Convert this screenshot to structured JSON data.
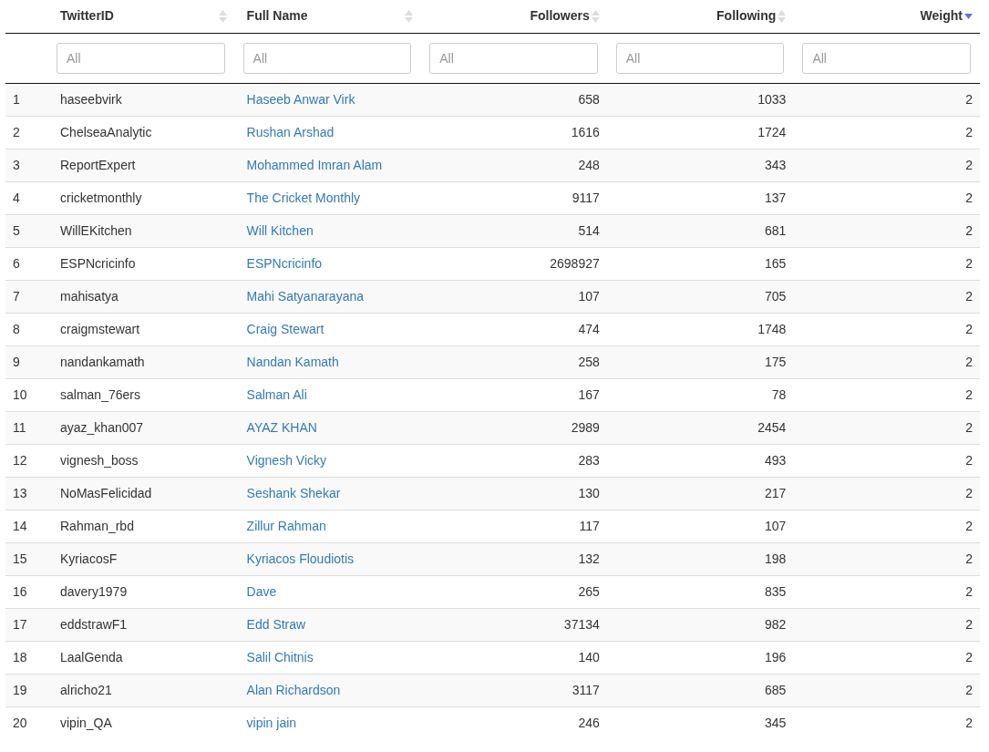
{
  "table": {
    "columns": [
      {
        "label": "TwitterID",
        "kind": "text",
        "sorted_descending": false
      },
      {
        "label": "Full Name",
        "kind": "text",
        "sorted_descending": false
      },
      {
        "label": "Followers",
        "kind": "number",
        "sorted_descending": false
      },
      {
        "label": "Following",
        "kind": "number",
        "sorted_descending": false
      },
      {
        "label": "Weight",
        "kind": "number",
        "sorted_descending": true
      }
    ],
    "filters": [
      {
        "placeholder": "All"
      },
      {
        "placeholder": "All"
      },
      {
        "placeholder": "All"
      },
      {
        "placeholder": "All"
      },
      {
        "placeholder": "All"
      }
    ],
    "rows": [
      {
        "index": "1",
        "twitter_id": "haseebvirk",
        "full_name": "Haseeb Anwar Virk",
        "followers": "658",
        "following": "1033",
        "weight": "2"
      },
      {
        "index": "2",
        "twitter_id": "ChelseaAnalytic",
        "full_name": "Rushan Arshad",
        "followers": "1616",
        "following": "1724",
        "weight": "2"
      },
      {
        "index": "3",
        "twitter_id": "ReportExpert",
        "full_name": "Mohammed Imran Alam",
        "followers": "248",
        "following": "343",
        "weight": "2"
      },
      {
        "index": "4",
        "twitter_id": "cricketmonthly",
        "full_name": "The Cricket Monthly",
        "followers": "9117",
        "following": "137",
        "weight": "2"
      },
      {
        "index": "5",
        "twitter_id": "WillEKitchen",
        "full_name": "Will Kitchen",
        "followers": "514",
        "following": "681",
        "weight": "2"
      },
      {
        "index": "6",
        "twitter_id": "ESPNcricinfo",
        "full_name": "ESPNcricinfo",
        "followers": "2698927",
        "following": "165",
        "weight": "2"
      },
      {
        "index": "7",
        "twitter_id": "mahisatya",
        "full_name": "Mahi Satyanarayana",
        "followers": "107",
        "following": "705",
        "weight": "2"
      },
      {
        "index": "8",
        "twitter_id": "craigmstewart",
        "full_name": "Craig Stewart",
        "followers": "474",
        "following": "1748",
        "weight": "2"
      },
      {
        "index": "9",
        "twitter_id": "nandankamath",
        "full_name": "Nandan Kamath",
        "followers": "258",
        "following": "175",
        "weight": "2"
      },
      {
        "index": "10",
        "twitter_id": "salman_76ers",
        "full_name": "Salman Ali",
        "followers": "167",
        "following": "78",
        "weight": "2"
      },
      {
        "index": "11",
        "twitter_id": "ayaz_khan007",
        "full_name": "AYAZ KHAN",
        "followers": "2989",
        "following": "2454",
        "weight": "2"
      },
      {
        "index": "12",
        "twitter_id": "vignesh_boss",
        "full_name": "Vignesh Vicky",
        "followers": "283",
        "following": "493",
        "weight": "2"
      },
      {
        "index": "13",
        "twitter_id": "NoMasFelicidad",
        "full_name": "Seshank Shekar",
        "followers": "130",
        "following": "217",
        "weight": "2"
      },
      {
        "index": "14",
        "twitter_id": "Rahman_rbd",
        "full_name": "Zillur Rahman",
        "followers": "117",
        "following": "107",
        "weight": "2"
      },
      {
        "index": "15",
        "twitter_id": "KyriacosF",
        "full_name": "Kyriacos Floudiotis",
        "followers": "132",
        "following": "198",
        "weight": "2"
      },
      {
        "index": "16",
        "twitter_id": "davery1979",
        "full_name": "Dave",
        "followers": "265",
        "following": "835",
        "weight": "2"
      },
      {
        "index": "17",
        "twitter_id": "eddstrawF1",
        "full_name": "Edd Straw",
        "followers": "37134",
        "following": "982",
        "weight": "2"
      },
      {
        "index": "18",
        "twitter_id": "LaalGenda",
        "full_name": "Salil Chitnis",
        "followers": "140",
        "following": "196",
        "weight": "2"
      },
      {
        "index": "19",
        "twitter_id": "alricho21",
        "full_name": "Alan Richardson",
        "followers": "3117",
        "following": "685",
        "weight": "2"
      },
      {
        "index": "20",
        "twitter_id": "vipin_QA",
        "full_name": "vipin jain",
        "followers": "246",
        "following": "345",
        "weight": "2"
      }
    ]
  }
}
